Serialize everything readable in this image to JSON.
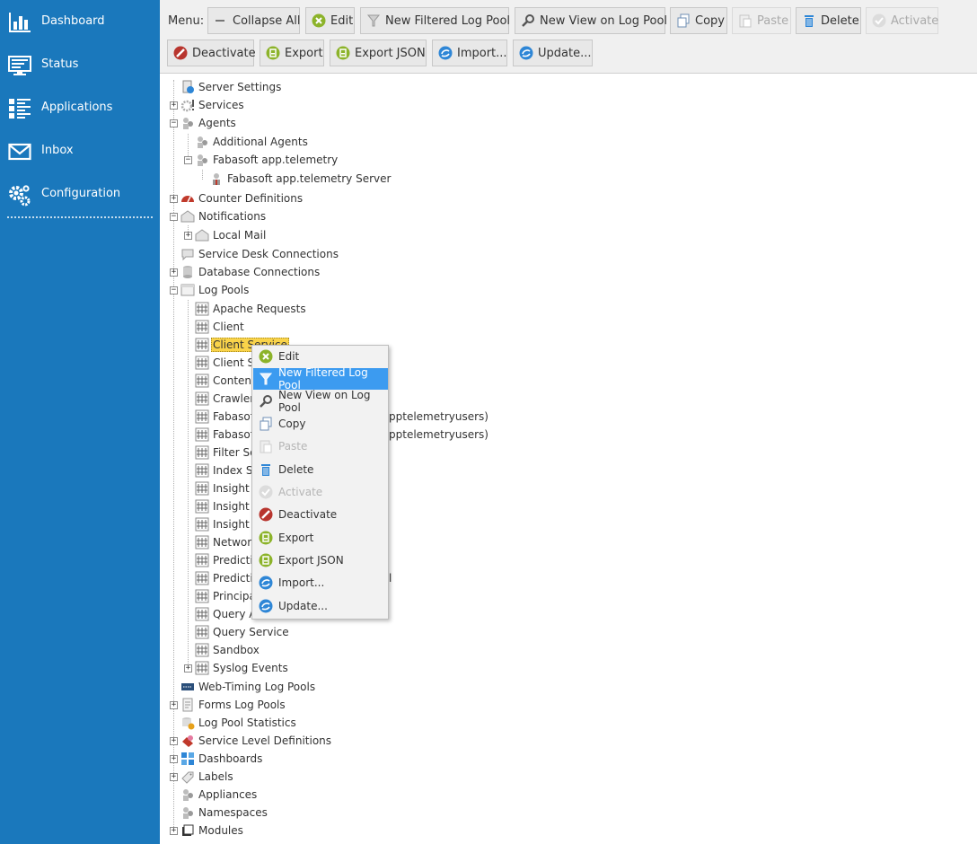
{
  "sidebar": {
    "items": [
      {
        "label": "Dashboard",
        "icon": "bar-chart-icon"
      },
      {
        "label": "Status",
        "icon": "monitor-icon"
      },
      {
        "label": "Applications",
        "icon": "applications-icon"
      },
      {
        "label": "Inbox",
        "icon": "envelope-icon"
      },
      {
        "label": "Configuration",
        "icon": "gears-icon"
      }
    ]
  },
  "toolbar": {
    "menu_label": "Menu:",
    "buttons": [
      {
        "label": "Collapse All",
        "icon": "minus-icon",
        "enabled": true
      },
      {
        "label": "Edit",
        "icon": "edit-icon",
        "enabled": true
      },
      {
        "label": "New Filtered Log Pool",
        "icon": "filter-icon",
        "enabled": true
      },
      {
        "label": "New View on Log Pool",
        "icon": "magnifier-icon",
        "enabled": true
      },
      {
        "label": "Copy",
        "icon": "copy-icon",
        "enabled": true
      },
      {
        "label": "Paste",
        "icon": "paste-icon",
        "enabled": false
      },
      {
        "label": "Delete",
        "icon": "trash-icon",
        "enabled": true
      },
      {
        "label": "Activate",
        "icon": "check-icon",
        "enabled": false
      },
      {
        "label": "Deactivate",
        "icon": "deactivate-icon",
        "enabled": true
      },
      {
        "label": "Export",
        "icon": "export-icon",
        "enabled": true
      },
      {
        "label": "Export JSON",
        "icon": "export-json-icon",
        "enabled": true
      },
      {
        "label": "Import...",
        "icon": "import-icon",
        "enabled": true
      },
      {
        "label": "Update...",
        "icon": "update-icon",
        "enabled": true
      }
    ]
  },
  "tree": {
    "items": [
      {
        "label": "Server Settings",
        "icon": "server-settings-icon"
      },
      {
        "label": "Services",
        "icon": "services-icon"
      },
      {
        "label": "Agents",
        "icon": "agents-icon"
      },
      {
        "label": "Additional Agents",
        "icon": "agents-icon"
      },
      {
        "label": "Fabasoft app.telemetry",
        "icon": "agents-icon"
      },
      {
        "label": "Fabasoft app.telemetry Server",
        "icon": "server-agent-icon"
      },
      {
        "label": "Counter Definitions",
        "icon": "gauge-icon"
      },
      {
        "label": "Notifications",
        "icon": "notification-icon"
      },
      {
        "label": "Local Mail",
        "icon": "mail-icon"
      },
      {
        "label": "Service Desk Connections",
        "icon": "service-desk-icon"
      },
      {
        "label": "Database Connections",
        "icon": "database-icon"
      },
      {
        "label": "Log Pools",
        "icon": "log-pools-icon"
      },
      {
        "label": "Apache Requests",
        "icon": "log-pool-icon"
      },
      {
        "label": "Client",
        "icon": "log-pool-icon"
      },
      {
        "label": "Client Service",
        "icon": "log-pool-icon"
      },
      {
        "label": "Client Se",
        "icon": "log-pool-icon"
      },
      {
        "label": "Content",
        "icon": "log-pool-icon"
      },
      {
        "label": "Crawler",
        "icon": "log-pool-icon"
      },
      {
        "label": "Fabasoft",
        "icon": "log-pool-icon",
        "suffix": "pptelemetryusers)"
      },
      {
        "label": "Fabasoft",
        "icon": "log-pool-icon",
        "suffix": "pptelemetryusers)"
      },
      {
        "label": "Filter Se",
        "icon": "log-pool-icon"
      },
      {
        "label": "Index Se",
        "icon": "log-pool-icon"
      },
      {
        "label": "Insight S",
        "icon": "log-pool-icon"
      },
      {
        "label": "Insight S",
        "icon": "log-pool-icon"
      },
      {
        "label": "Insight S",
        "icon": "log-pool-icon"
      },
      {
        "label": "Network",
        "icon": "log-pool-icon"
      },
      {
        "label": "Predictio",
        "icon": "log-pool-icon"
      },
      {
        "label": "Predictio",
        "icon": "log-pool-icon",
        "suffix": "l"
      },
      {
        "label": "Principa",
        "icon": "log-pool-icon"
      },
      {
        "label": "Query A",
        "icon": "log-pool-icon"
      },
      {
        "label": "Query Service",
        "icon": "log-pool-icon"
      },
      {
        "label": "Sandbox",
        "icon": "log-pool-icon"
      },
      {
        "label": "Syslog Events",
        "icon": "log-pool-icon"
      },
      {
        "label": "Web-Timing Log Pools",
        "icon": "web-timing-icon"
      },
      {
        "label": "Forms Log Pools",
        "icon": "forms-icon"
      },
      {
        "label": "Log Pool Statistics",
        "icon": "statistics-icon"
      },
      {
        "label": "Service Level Definitions",
        "icon": "service-level-icon"
      },
      {
        "label": "Dashboards",
        "icon": "dashboards-icon"
      },
      {
        "label": "Labels",
        "icon": "labels-icon"
      },
      {
        "label": "Appliances",
        "icon": "agents-icon"
      },
      {
        "label": "Namespaces",
        "icon": "agents-icon"
      },
      {
        "label": "Modules",
        "icon": "modules-icon"
      }
    ]
  },
  "context_menu": {
    "items": [
      {
        "label": "Edit",
        "icon": "edit-icon",
        "enabled": true
      },
      {
        "label": "New Filtered Log Pool",
        "icon": "filter-icon",
        "enabled": true,
        "highlighted": true
      },
      {
        "label": "New View on Log Pool",
        "icon": "magnifier-icon",
        "enabled": true
      },
      {
        "label": "Copy",
        "icon": "copy-icon",
        "enabled": true
      },
      {
        "label": "Paste",
        "icon": "paste-icon",
        "enabled": false
      },
      {
        "label": "Delete",
        "icon": "trash-icon",
        "enabled": true
      },
      {
        "label": "Activate",
        "icon": "check-icon",
        "enabled": false
      },
      {
        "label": "Deactivate",
        "icon": "deactivate-icon",
        "enabled": true
      },
      {
        "label": "Export",
        "icon": "export-icon",
        "enabled": true
      },
      {
        "label": "Export JSON",
        "icon": "export-json-icon",
        "enabled": true
      },
      {
        "label": "Import...",
        "icon": "import-icon",
        "enabled": true
      },
      {
        "label": "Update...",
        "icon": "update-icon",
        "enabled": true
      }
    ]
  },
  "colors": {
    "sidebar_bg": "#1a78bc",
    "selection": "#f9d34a",
    "menu_highlight": "#3c9bf0"
  }
}
